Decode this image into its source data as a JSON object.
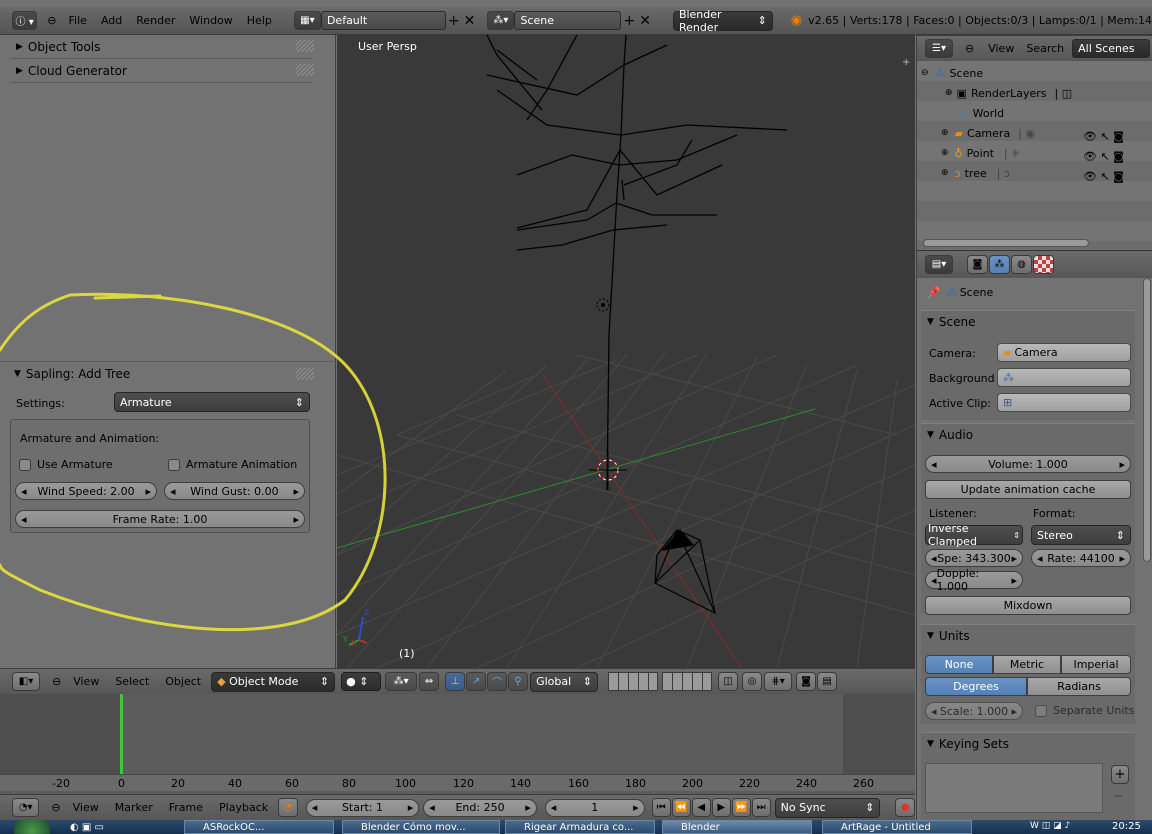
{
  "topbar": {
    "menu": [
      "File",
      "Add",
      "Render",
      "Window",
      "Help"
    ],
    "layout": "Default",
    "scene": "Scene",
    "engine": "Blender Render",
    "stats": "v2.65 | Verts:178 | Faces:0 | Objects:0/3 | Lamps:0/1 | Mem:14"
  },
  "toolshelf": {
    "panels": [
      "Object Tools",
      "Cloud Generator"
    ],
    "operator_title": "Sapling: Add Tree",
    "settings_label": "Settings:",
    "settings_value": "Armature",
    "box_title": "Armature and Animation:",
    "use_armature": "Use Armature",
    "armature_animation": "Armature Animation",
    "wind_speed": "Wind Speed: 2.00",
    "wind_gust": "Wind Gust: 0.00",
    "frame_rate": "Frame Rate: 1.00"
  },
  "viewport": {
    "label": "User Persp",
    "frame": "(1)",
    "axis_z": "Z",
    "axis_y": "Y",
    "axis_x": "X",
    "header": {
      "menu": [
        "View",
        "Select",
        "Object"
      ],
      "mode": "Object Mode",
      "orientation": "Global"
    }
  },
  "outliner": {
    "menu": [
      "View",
      "Search"
    ],
    "filter": "All Scenes",
    "items": [
      {
        "label": "Scene",
        "level": 0
      },
      {
        "label": "RenderLayers",
        "level": 1
      },
      {
        "label": "World",
        "level": 1
      },
      {
        "label": "Camera",
        "level": 1
      },
      {
        "label": "Point",
        "level": 1
      },
      {
        "label": "tree",
        "level": 1
      }
    ]
  },
  "properties": {
    "breadcrumb": "Scene",
    "scene_panel": {
      "title": "Scene",
      "camera_label": "Camera:",
      "camera_value": "Camera",
      "background_label": "Background",
      "clip_label": "Active Clip:"
    },
    "audio_panel": {
      "title": "Audio",
      "volume": "Volume: 1.000",
      "update_cache": "Update animation cache",
      "listener_label": "Listener:",
      "format_label": "Format:",
      "listener_value": "Inverse Clamped",
      "format_value": "Stereo",
      "speed": "Spe: 343.300",
      "rate": "Rate: 44100",
      "doppler": "Dopple: 1.000",
      "mixdown": "Mixdown"
    },
    "units_panel": {
      "title": "Units",
      "systems": [
        "None",
        "Metric",
        "Imperial"
      ],
      "rotation": [
        "Degrees",
        "Radians"
      ],
      "scale": "Scale: 1.000",
      "separate": "Separate Units"
    },
    "keying_panel": {
      "title": "Keying Sets"
    }
  },
  "timeline": {
    "ticks": [
      "-20",
      "0",
      "20",
      "40",
      "60",
      "80",
      "100",
      "120",
      "140",
      "160",
      "180",
      "200",
      "220",
      "240",
      "260"
    ],
    "menu": [
      "View",
      "Marker",
      "Frame",
      "Playback"
    ],
    "start": "Start: 1",
    "end": "End: 250",
    "current": "1",
    "sync": "No Sync"
  },
  "taskbar": {
    "items": [
      "ASRockOC...",
      "Blender Cómo mov...",
      "Rigear Armadura co...",
      "Blender",
      "ArtRage - Untitled"
    ],
    "clock": "20:25"
  }
}
